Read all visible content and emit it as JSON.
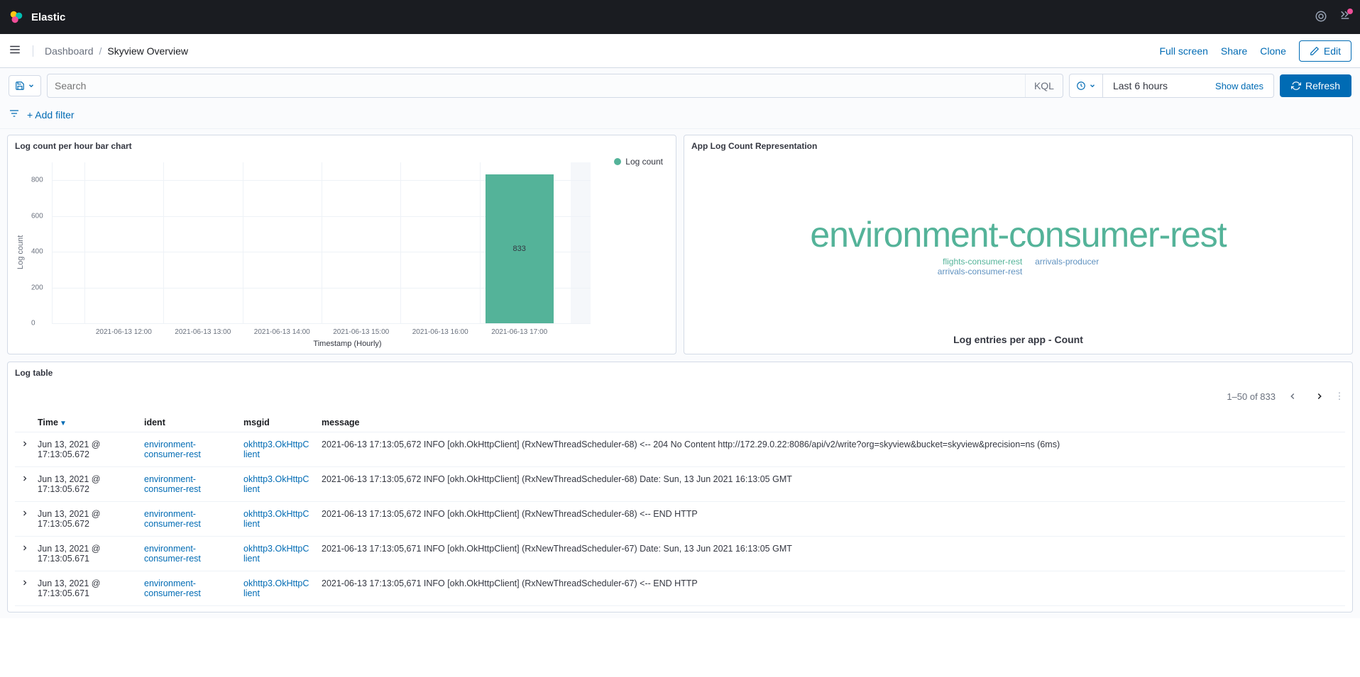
{
  "header": {
    "brand": "Elastic"
  },
  "breadcrumbs": {
    "parent": "Dashboard",
    "current": "Skyview Overview"
  },
  "nav_actions": {
    "fullscreen": "Full screen",
    "share": "Share",
    "clone": "Clone",
    "edit": "Edit"
  },
  "query": {
    "search_placeholder": "Search",
    "kql": "KQL",
    "date_range": "Last 6 hours",
    "show_dates": "Show dates",
    "refresh": "Refresh",
    "add_filter": "+ Add filter"
  },
  "panels": {
    "bar_chart": {
      "title": "Log count per hour bar chart",
      "legend": "Log count",
      "xlabel": "Timestamp (Hourly)",
      "ylabel": "Log count"
    },
    "cloud": {
      "title": "App Log Count Representation",
      "big": "environment-consumer-rest",
      "small1": "flights-consumer-rest",
      "small2": "arrivals-consumer-rest",
      "small3": "arrivals-producer",
      "caption": "Log entries per app - Count"
    },
    "log_table": {
      "title": "Log table",
      "range": "1–50 of 833",
      "columns": {
        "time": "Time",
        "ident": "ident",
        "msgid": "msgid",
        "message": "message"
      }
    }
  },
  "chart_data": {
    "type": "bar",
    "categories": [
      "2021-06-13 12:00",
      "2021-06-13 13:00",
      "2021-06-13 14:00",
      "2021-06-13 15:00",
      "2021-06-13 16:00",
      "2021-06-13 17:00"
    ],
    "values": [
      0,
      0,
      0,
      0,
      0,
      833
    ],
    "ylabel": "Log count",
    "xlabel": "Timestamp (Hourly)",
    "y_ticks": [
      0,
      200,
      400,
      600,
      800
    ],
    "ylim": [
      0,
      900
    ],
    "legend": [
      "Log count"
    ]
  },
  "log_rows": [
    {
      "time": "Jun 13, 2021 @ 17:13:05.672",
      "ident": "environment-consumer-rest",
      "msgid": "okhttp3.OkHttpClient",
      "message": "2021-06-13 17:13:05,672 INFO  [okh.OkHttpClient] (RxNewThreadScheduler-68) <-- 204 No Content http://172.29.0.22:8086/api/v2/write?org=skyview&bucket=skyview&precision=ns (6ms)"
    },
    {
      "time": "Jun 13, 2021 @ 17:13:05.672",
      "ident": "environment-consumer-rest",
      "msgid": "okhttp3.OkHttpClient",
      "message": "2021-06-13 17:13:05,672 INFO  [okh.OkHttpClient] (RxNewThreadScheduler-68) Date: Sun, 13 Jun 2021 16:13:05 GMT"
    },
    {
      "time": "Jun 13, 2021 @ 17:13:05.672",
      "ident": "environment-consumer-rest",
      "msgid": "okhttp3.OkHttpClient",
      "message": "2021-06-13 17:13:05,672 INFO  [okh.OkHttpClient] (RxNewThreadScheduler-68) <-- END HTTP"
    },
    {
      "time": "Jun 13, 2021 @ 17:13:05.671",
      "ident": "environment-consumer-rest",
      "msgid": "okhttp3.OkHttpClient",
      "message": "2021-06-13 17:13:05,671 INFO  [okh.OkHttpClient] (RxNewThreadScheduler-67) Date: Sun, 13 Jun 2021 16:13:05 GMT"
    },
    {
      "time": "Jun 13, 2021 @ 17:13:05.671",
      "ident": "environment-consumer-rest",
      "msgid": "okhttp3.OkHttpClient",
      "message": "2021-06-13 17:13:05,671 INFO  [okh.OkHttpClient] (RxNewThreadScheduler-67) <-- END HTTP"
    }
  ]
}
